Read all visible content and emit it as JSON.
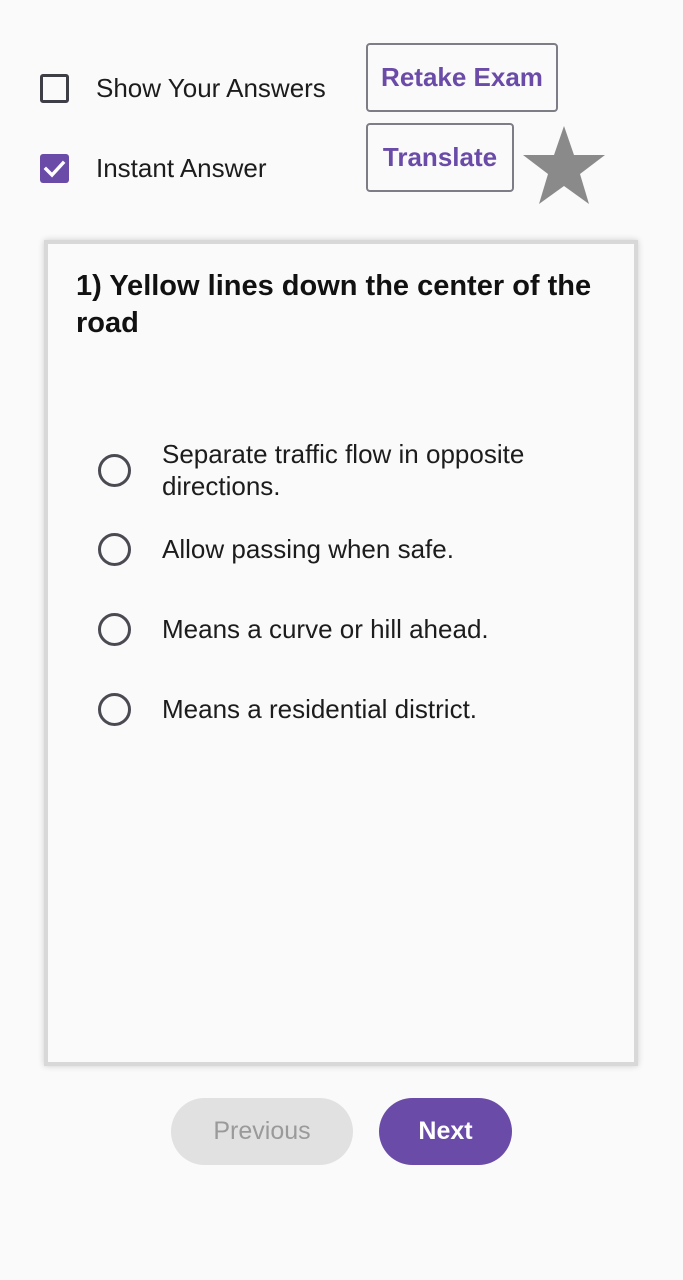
{
  "controls": {
    "show_answers": {
      "label": "Show Your Answers",
      "checked": false
    },
    "instant_answer": {
      "label": "Instant Answer",
      "checked": true
    },
    "retake_label": "Retake Exam",
    "translate_label": "Translate",
    "favorite_icon": "star-icon"
  },
  "question": {
    "title": "1) Yellow lines down the center of the road",
    "options": [
      "Separate traffic flow in opposite directions.",
      "Allow passing when safe.",
      "Means a curve or hill ahead.",
      "Means a residential district."
    ]
  },
  "navigation": {
    "previous_label": "Previous",
    "next_label": "Next"
  },
  "colors": {
    "accent": "#6a4ca8",
    "star": "#8a8a8a",
    "disabled_button": "#e1e1e1"
  }
}
